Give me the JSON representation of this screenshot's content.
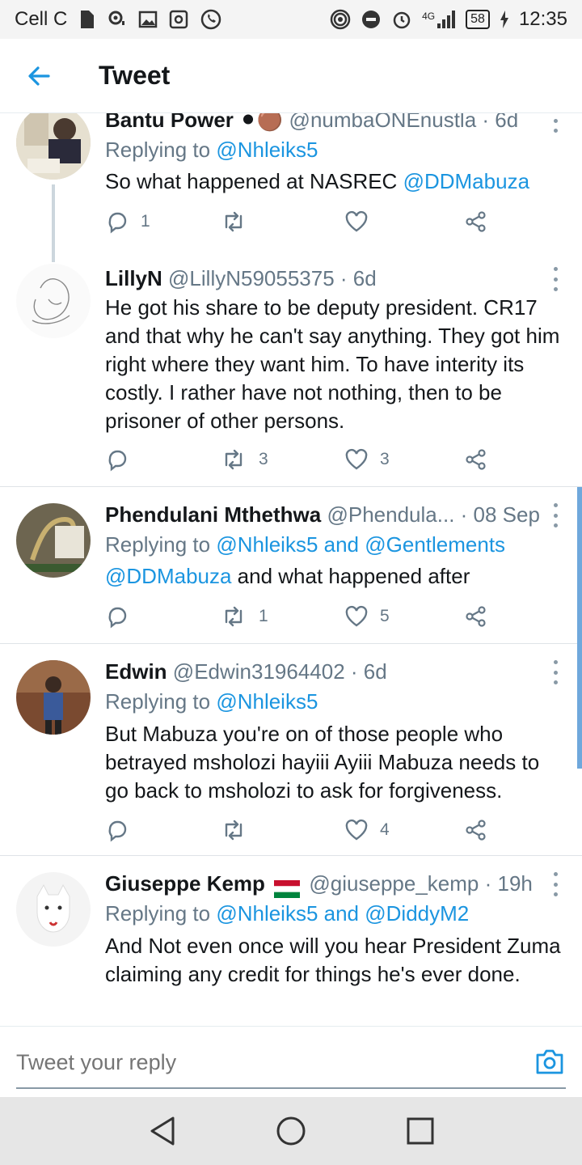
{
  "status_bar": {
    "carrier": "Cell C",
    "network": "4G",
    "battery": "58",
    "time": "12:35"
  },
  "header": {
    "title": "Tweet"
  },
  "tweets": [
    {
      "name": "Bantu Power",
      "name_suffix": " ⚫🟤",
      "handle": "@numbaONEnustla",
      "time": "· 6d",
      "replying_label": "Replying to",
      "replying_to": "@Nhleiks5",
      "text": "So what happened at NASREC",
      "text_link": "@DDMabuza",
      "replies": "1",
      "retweets": "",
      "likes": ""
    },
    {
      "name": "LillyN",
      "handle": "@LillyN59055375",
      "time": "· 6d",
      "text": "He got his share to be deputy president. CR17 and that why he can't say anything. They got him right where they want him. To have interity its costly. I rather have not nothing, then to be prisoner of other persons.",
      "replies": "",
      "retweets": "3",
      "likes": "3"
    },
    {
      "name": "Phendulani Mthethwa",
      "handle": "@Phendula...",
      "time": "· 08 Sep",
      "replying_label": "Replying to",
      "replying_to": "@Nhleiks5 and @Gentlements",
      "text_link": "@DDMabuza",
      "text": " and what happened after",
      "replies": "",
      "retweets": "1",
      "likes": "5"
    },
    {
      "name": "Edwin",
      "handle": "@Edwin31964402",
      "time": "· 6d",
      "replying_label": "Replying to",
      "replying_to": "@Nhleiks5",
      "text": "But Mabuza you're on of those people who betrayed msholozi hayiii Ayiii Mabuza needs to go back to msholozi to ask for forgiveness.",
      "replies": "",
      "retweets": "",
      "likes": "4"
    },
    {
      "name": "Giuseppe Kemp",
      "handle": "@giuseppe_kemp",
      "time": "· 19h",
      "replying_label": "Replying to",
      "replying_to": "@Nhleiks5 and @DiddyM2",
      "text": "And Not even once will you hear President Zuma claiming any credit for things he's ever done."
    }
  ],
  "reply_bar": {
    "placeholder": "Tweet your reply"
  },
  "colors": {
    "accent": "#1b95e0",
    "muted": "#657786",
    "text": "#14171a"
  }
}
